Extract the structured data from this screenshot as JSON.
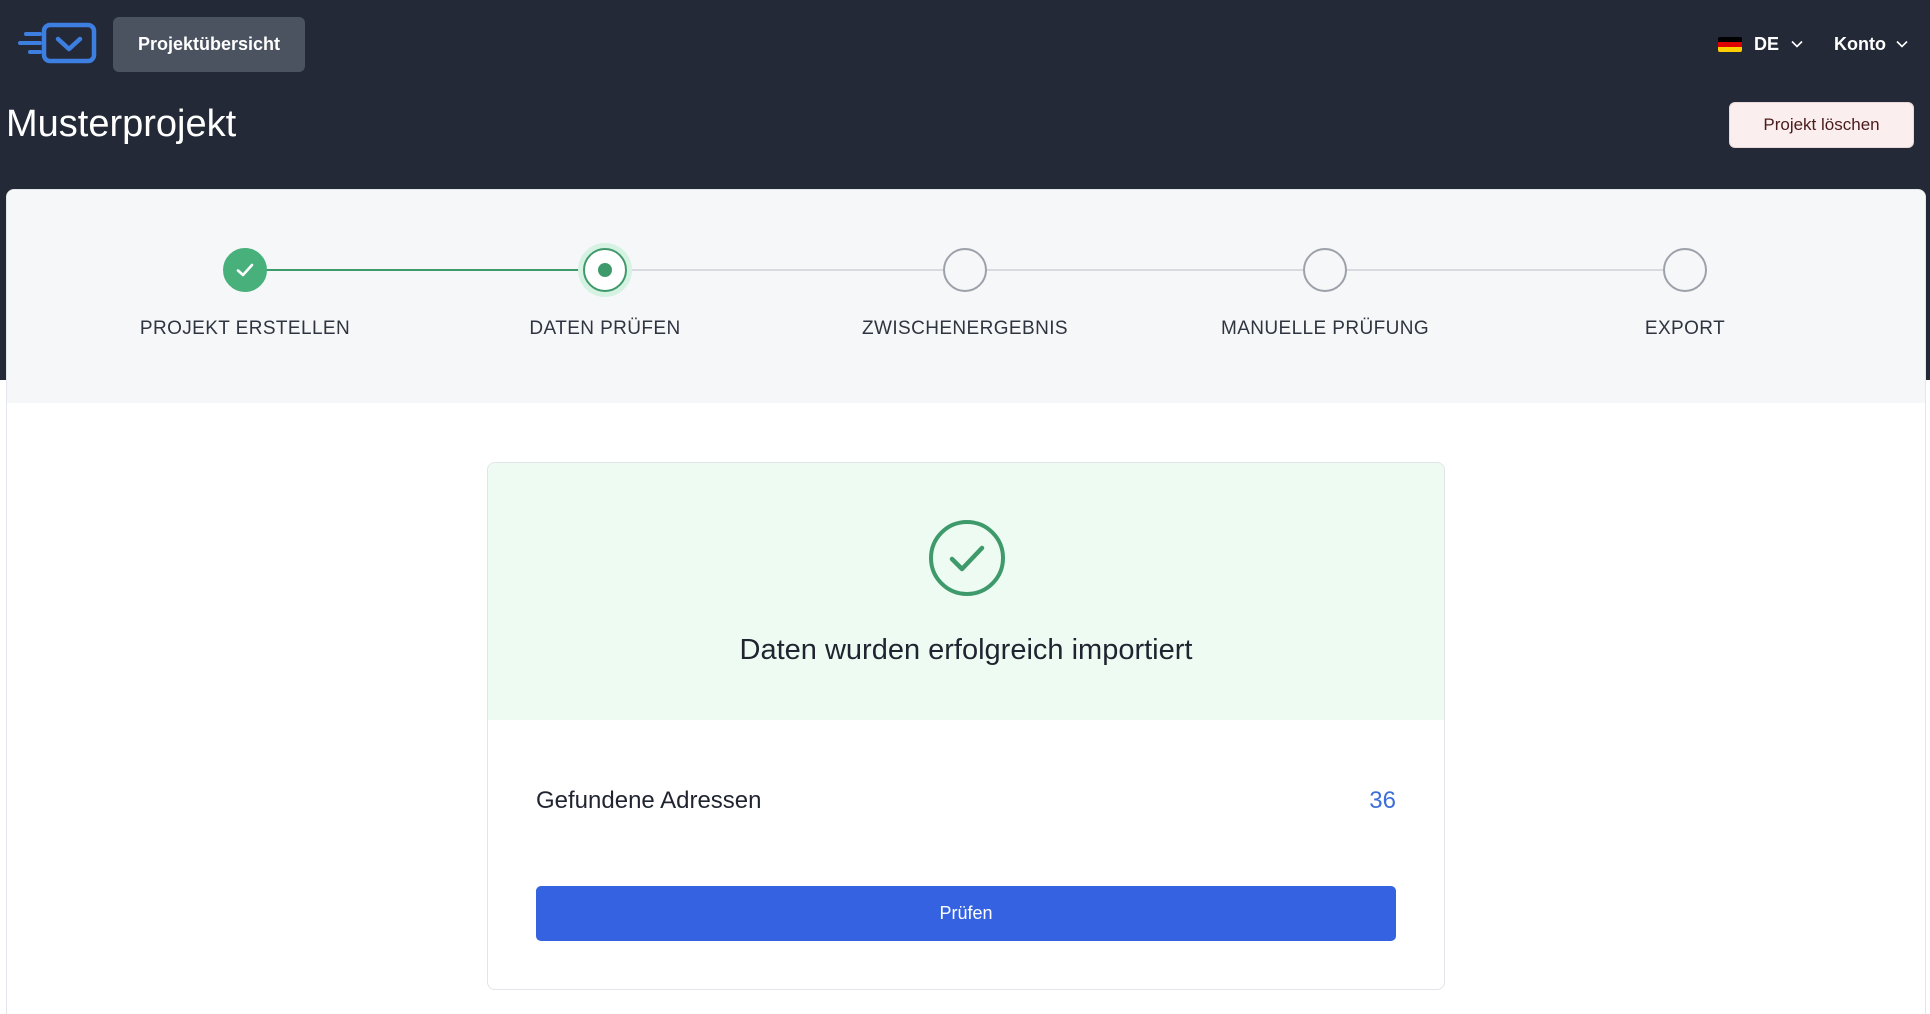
{
  "header": {
    "nav_button_label": "Projektübersicht",
    "language": {
      "code": "DE",
      "flag_colors": [
        "#000000",
        "#dd0000",
        "#ffce00"
      ]
    },
    "account_label": "Konto"
  },
  "project": {
    "title": "Musterprojekt",
    "delete_label": "Projekt löschen"
  },
  "stepper": {
    "steps": [
      {
        "label": "PROJEKT ERSTELLEN",
        "state": "done"
      },
      {
        "label": "DATEN PRÜFEN",
        "state": "active"
      },
      {
        "label": "ZWISCHENERGEBNIS",
        "state": "pending"
      },
      {
        "label": "MANUELLE PRÜFUNG",
        "state": "pending"
      },
      {
        "label": "EXPORT",
        "state": "pending"
      }
    ]
  },
  "result_card": {
    "success_message": "Daten wurden erfolgreich importiert",
    "found_label": "Gefundene Adressen",
    "found_value": "36",
    "check_button_label": "Prüfen"
  },
  "colors": {
    "header_bg": "#232936",
    "success_green": "#3f9a6b",
    "primary_blue": "#3462e0",
    "value_blue": "#3d6fd8"
  }
}
